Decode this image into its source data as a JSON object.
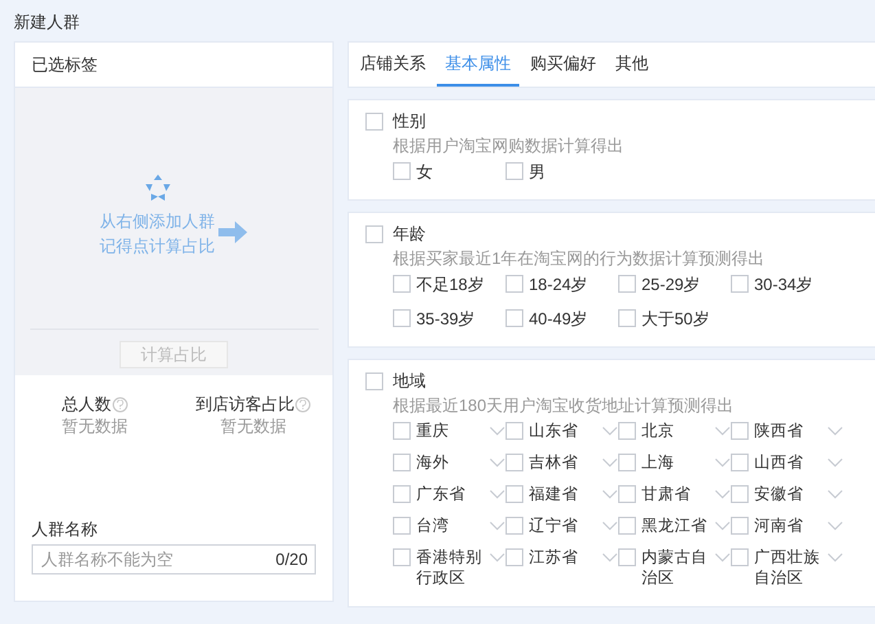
{
  "page_title": "新建人群",
  "selected_panel": {
    "title": "已选标签",
    "empty_hint": [
      "从右侧添加人群",
      "记得点计算占比"
    ],
    "calc_button": {
      "label": "计算占比",
      "disabled": true
    },
    "stats": [
      {
        "label": "总人数",
        "value": "暂无数据"
      },
      {
        "label": "到店访客占比",
        "value": "暂无数据"
      }
    ],
    "name_field": {
      "label": "人群名称",
      "placeholder": "人群名称不能为空",
      "counter": "0/20"
    }
  },
  "tabs": [
    {
      "label": "店铺关系",
      "selected": false
    },
    {
      "label": "基本属性",
      "selected": true
    },
    {
      "label": "购买偏好",
      "selected": false
    },
    {
      "label": "其他",
      "selected": false
    }
  ],
  "sections": [
    {
      "title": "性别",
      "checked": false,
      "description": "根据用户淘宝网购数据计算得出",
      "options": [
        {
          "label": "女",
          "checked": false
        },
        {
          "label": "男",
          "checked": false
        }
      ]
    },
    {
      "title": "年龄",
      "checked": false,
      "description": "根据买家最近1年在淘宝网的行为数据计算预测得出",
      "options": [
        {
          "label": "不足18岁",
          "checked": false
        },
        {
          "label": "18-24岁",
          "checked": false
        },
        {
          "label": "25-29岁",
          "checked": false
        },
        {
          "label": "30-34岁",
          "checked": false
        },
        {
          "label": "35-39岁",
          "checked": false
        },
        {
          "label": "40-49岁",
          "checked": false
        },
        {
          "label": "大于50岁",
          "checked": false
        }
      ]
    },
    {
      "title": "地域",
      "checked": false,
      "description": "根据最近180天用户淘宝收货地址计算预测得出",
      "expandable_options": true,
      "options": [
        {
          "label": "重庆",
          "checked": false
        },
        {
          "label": "山东省",
          "checked": false
        },
        {
          "label": "北京",
          "checked": false
        },
        {
          "label": "陕西省",
          "checked": false
        },
        {
          "label": "海外",
          "checked": false
        },
        {
          "label": "吉林省",
          "checked": false
        },
        {
          "label": "上海",
          "checked": false
        },
        {
          "label": "山西省",
          "checked": false
        },
        {
          "label": "广东省",
          "checked": false
        },
        {
          "label": "福建省",
          "checked": false
        },
        {
          "label": "甘肃省",
          "checked": false
        },
        {
          "label": "安徽省",
          "checked": false
        },
        {
          "label": "台湾",
          "checked": false
        },
        {
          "label": "辽宁省",
          "checked": false
        },
        {
          "label": "黑龙江省",
          "checked": false
        },
        {
          "label": "河南省",
          "checked": false
        },
        {
          "label": "香港特别行政区",
          "checked": false
        },
        {
          "label": "江苏省",
          "checked": false
        },
        {
          "label": "内蒙古自治区",
          "checked": false
        },
        {
          "label": "广西壮族自治区",
          "checked": false
        }
      ]
    }
  ]
}
